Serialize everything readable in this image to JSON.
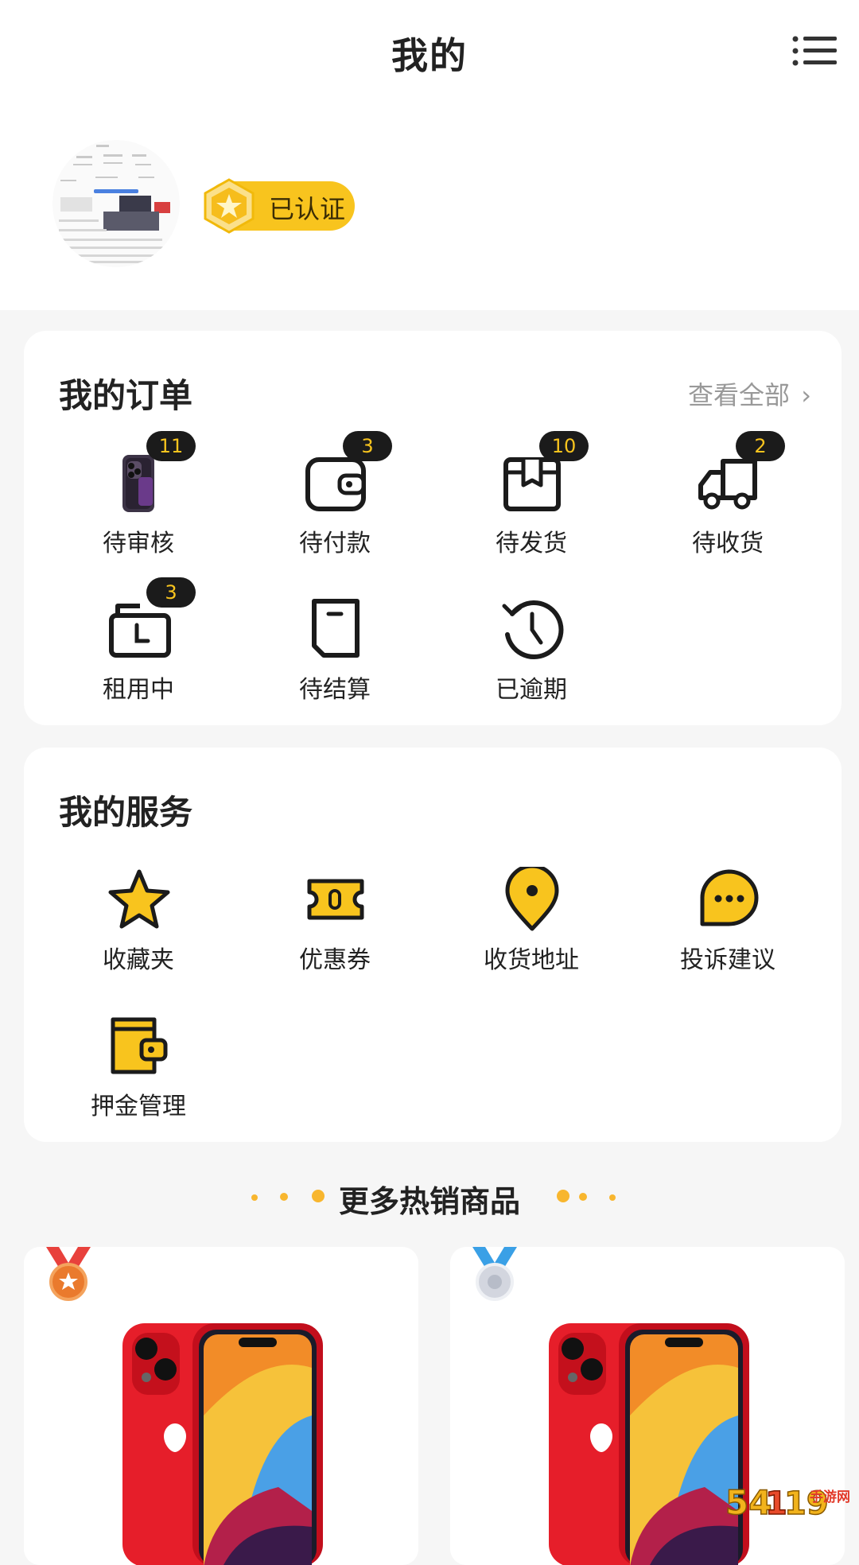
{
  "header": {
    "title": "我的",
    "menu_icon": "list-menu-icon"
  },
  "profile": {
    "verified_label": "已认证"
  },
  "orders": {
    "title": "我的订单",
    "view_all": "查看全部",
    "items": [
      {
        "label": "待审核",
        "count": "11",
        "icon": "phone-thumbnail"
      },
      {
        "label": "待付款",
        "count": "3",
        "icon": "wallet-icon"
      },
      {
        "label": "待发货",
        "count": "10",
        "icon": "package-icon"
      },
      {
        "label": "待收货",
        "count": "2",
        "icon": "truck-icon"
      },
      {
        "label": "租用中",
        "count": "3",
        "icon": "rental-clock-icon"
      },
      {
        "label": "待结算",
        "count": "",
        "icon": "settlement-icon"
      },
      {
        "label": "已逾期",
        "count": "",
        "icon": "history-icon"
      }
    ]
  },
  "services": {
    "title": "我的服务",
    "items": [
      {
        "label": "收藏夹",
        "icon": "star-icon"
      },
      {
        "label": "优惠券",
        "icon": "coupon-icon"
      },
      {
        "label": "收货地址",
        "icon": "location-pin-icon"
      },
      {
        "label": "投诉建议",
        "icon": "chat-bubble-icon"
      },
      {
        "label": "押金管理",
        "icon": "deposit-wallet-icon"
      }
    ]
  },
  "hot": {
    "title": "更多热销商品"
  },
  "watermark": {
    "text": "54119手游网"
  },
  "colors": {
    "accent": "#f8c41e",
    "badge_bg": "#1b1b1b",
    "badge_text": "#f8c41e",
    "page_bg": "#f6f6f6"
  }
}
